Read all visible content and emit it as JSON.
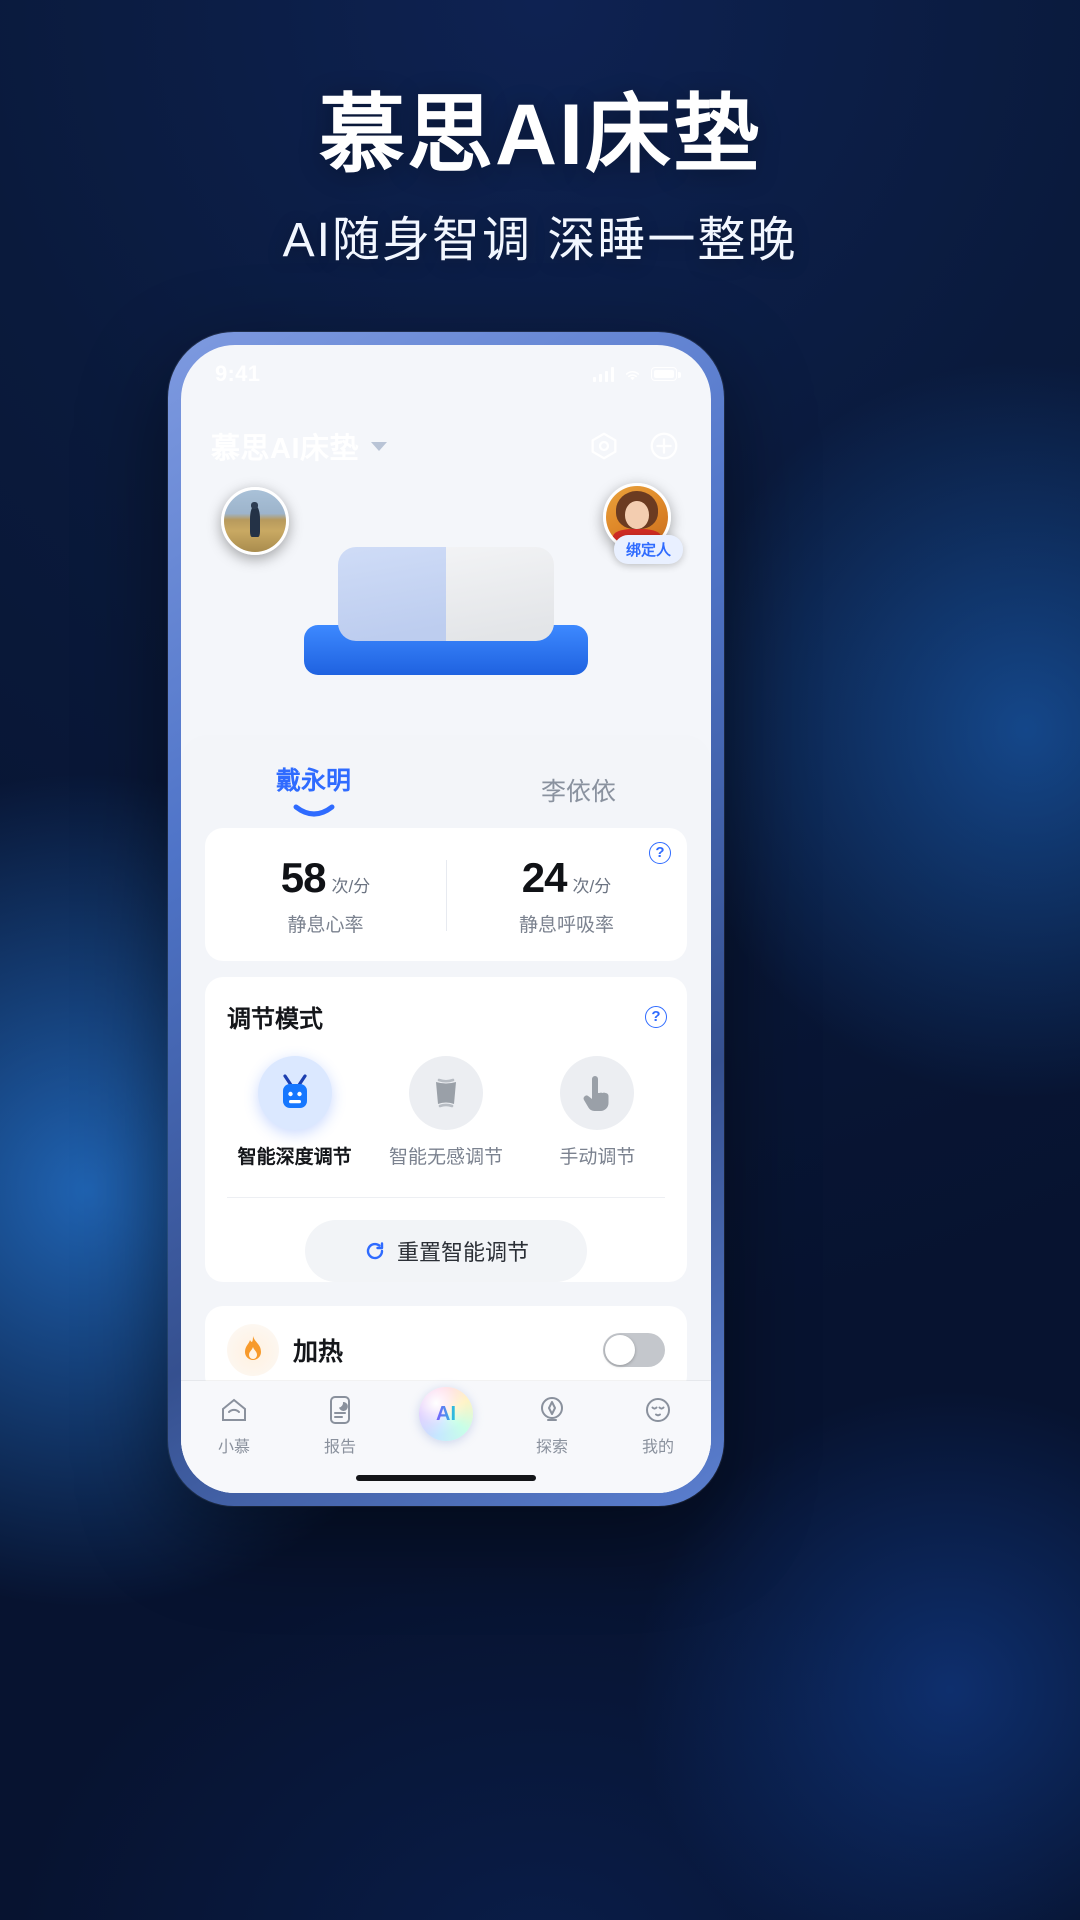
{
  "promo": {
    "title": "慕思AI床垫",
    "subtitle": "AI随身智调 深睡一整晚"
  },
  "status_bar": {
    "time": "9:41",
    "signal_icon": "signal-bars-icon",
    "wifi_icon": "wifi-icon",
    "battery_icon": "battery-icon"
  },
  "app_header": {
    "title": "慕思AI床垫",
    "dropdown_icon": "chevron-down-icon",
    "device_icon": "device-hexagon-icon",
    "add_icon": "plus-circle-icon"
  },
  "bed": {
    "left_avatar": "user-avatar-left",
    "right_avatar": "user-avatar-right",
    "bind_badge": "绑定人"
  },
  "user_tabs": [
    {
      "name": "戴永明",
      "active": true
    },
    {
      "name": "李依依",
      "active": false
    }
  ],
  "vitals": {
    "help_icon": "help-circle-icon",
    "items": [
      {
        "value": "58",
        "unit": "次/分",
        "label": "静息心率"
      },
      {
        "value": "24",
        "unit": "次/分",
        "label": "静息呼吸率"
      }
    ]
  },
  "adjust_mode": {
    "title": "调节模式",
    "help_icon": "help-circle-icon",
    "modes": [
      {
        "label": "智能深度调节",
        "icon": "robot-icon",
        "active": true
      },
      {
        "label": "智能无感调节",
        "icon": "mattress-icon",
        "active": false
      },
      {
        "label": "手动调节",
        "icon": "hand-pointer-icon",
        "active": false
      }
    ],
    "reset_label": "重置智能调节",
    "reset_icon": "refresh-icon"
  },
  "heating": {
    "label": "加热",
    "icon": "flame-icon",
    "toggle_on": false
  },
  "bottom_nav": [
    {
      "label": "小慕",
      "icon": "home-icon"
    },
    {
      "label": "报告",
      "icon": "report-icon"
    },
    {
      "label": "AI",
      "icon": "ai-orb-icon"
    },
    {
      "label": "探索",
      "icon": "compass-icon"
    },
    {
      "label": "我的",
      "icon": "profile-face-icon"
    }
  ],
  "colors": {
    "accent": "#2f6bff",
    "promo_bg_dark": "#071330",
    "promo_bg_blue": "#1f5fae",
    "bed_base": "#2f7bf6"
  }
}
